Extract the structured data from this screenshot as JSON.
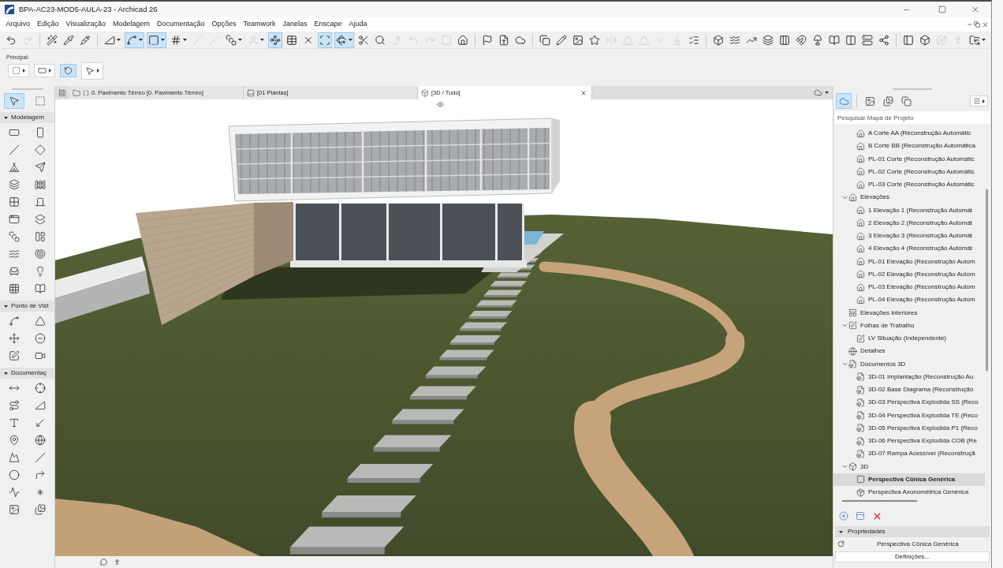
{
  "window": {
    "title": "BPA-AC23-MOD5-AULA-23 - Archicad 26"
  },
  "menu": [
    "Arquivo",
    "Edição",
    "Visualização",
    "Modelagem",
    "Documentação",
    "Opções",
    "Teamwork",
    "Janelas",
    "Enscape",
    "Ajuda"
  ],
  "toolbar": [
    {
      "on": false,
      "disabled": false
    },
    {
      "on": false,
      "disabled": true
    },
    {
      "on": false,
      "disabled": false
    },
    {
      "on": false,
      "disabled": false
    },
    {
      "on": false,
      "disabled": false
    },
    {
      "on": false,
      "disabled": false
    },
    {
      "on": true,
      "disabled": false
    },
    {
      "on": true,
      "disabled": false
    },
    {
      "on": false,
      "disabled": false
    },
    {
      "on": false,
      "disabled": true
    },
    {
      "on": false,
      "disabled": true
    },
    {
      "on": false,
      "disabled": false
    },
    {
      "on": false,
      "disabled": true
    },
    {
      "on": true,
      "disabled": false
    },
    {
      "on": false,
      "disabled": false
    },
    {
      "on": false,
      "disabled": false
    },
    {
      "on": true,
      "disabled": false
    },
    {
      "on": true,
      "disabled": false
    },
    {
      "on": false,
      "disabled": false
    },
    {
      "on": false,
      "disabled": false
    },
    {
      "on": false,
      "disabled": true
    },
    {
      "on": false,
      "disabled": true
    },
    {
      "on": false,
      "disabled": true
    },
    {
      "on": false,
      "disabled": true
    },
    {
      "on": false,
      "disabled": false
    },
    {
      "on": false,
      "disabled": false
    },
    {
      "on": false,
      "disabled": false
    },
    {
      "on": false,
      "disabled": false
    },
    {
      "on": false,
      "disabled": false
    },
    {
      "on": false,
      "disabled": false
    },
    {
      "on": false,
      "disabled": false
    },
    {
      "on": false,
      "disabled": false
    },
    {
      "on": false,
      "disabled": true
    },
    {
      "on": false,
      "disabled": true
    },
    {
      "on": false,
      "disabled": true
    },
    {
      "on": false,
      "disabled": true
    },
    {
      "on": false,
      "disabled": true
    },
    {
      "on": false,
      "disabled": false
    },
    {
      "on": false,
      "disabled": false
    },
    {
      "on": false,
      "disabled": false
    },
    {
      "on": false,
      "disabled": false
    },
    {
      "on": false,
      "disabled": false
    },
    {
      "on": false,
      "disabled": false
    },
    {
      "on": false,
      "disabled": false
    },
    {
      "on": false,
      "disabled": false
    },
    {
      "on": false,
      "disabled": false
    },
    {
      "on": false,
      "disabled": false
    },
    {
      "on": false,
      "disabled": false
    },
    {
      "on": false,
      "disabled": false
    },
    {
      "on": false,
      "disabled": false
    },
    {
      "on": false,
      "disabled": false
    },
    {
      "on": false,
      "disabled": true
    },
    {
      "on": false,
      "disabled": true
    },
    {
      "on": false,
      "disabled": false
    }
  ],
  "toolbar_2": {
    "label": "Principal:",
    "buttons": [
      {
        "on": false
      },
      {
        "on": false
      },
      {
        "on": true
      },
      {
        "on": false
      }
    ]
  },
  "toolbox": {
    "top_tools": [
      {
        "selected": true
      },
      {
        "selected": false
      }
    ],
    "sections": [
      {
        "label": "Modelagem",
        "expanded": true,
        "tools": [
          {
            "selected": false
          },
          {
            "selected": false
          },
          {
            "selected": false
          },
          {
            "selected": false
          },
          {
            "selected": false
          },
          {
            "selected": false
          },
          {
            "selected": false
          },
          {
            "selected": false
          },
          {
            "selected": false
          },
          {
            "selected": false
          },
          {
            "selected": false
          },
          {
            "selected": false
          },
          {
            "selected": false
          },
          {
            "selected": false
          },
          {
            "selected": false
          },
          {
            "selected": false
          },
          {
            "selected": false
          },
          {
            "selected": false
          },
          {
            "selected": false
          },
          {
            "selected": false
          }
        ]
      },
      {
        "label": "Ponto de Vist",
        "expanded": true,
        "tools": [
          {
            "selected": false
          },
          {
            "selected": false
          },
          {
            "selected": false
          },
          {
            "selected": false
          },
          {
            "selected": false
          },
          {
            "selected": false
          }
        ]
      },
      {
        "label": "Documentaç",
        "expanded": true,
        "tools": [
          {
            "selected": false
          },
          {
            "selected": false
          },
          {
            "selected": false
          },
          {
            "selected": false
          },
          {
            "selected": false
          },
          {
            "selected": false
          },
          {
            "selected": false
          },
          {
            "selected": false
          },
          {
            "selected": false
          },
          {
            "selected": false
          },
          {
            "selected": false
          },
          {
            "selected": false
          },
          {
            "selected": false
          },
          {
            "selected": false
          },
          {
            "selected": false
          },
          {
            "selected": false
          }
        ]
      }
    ]
  },
  "tabs": [
    {
      "kind": "story",
      "label": "0. Pavimento Térreo [0. Pavimento Térreo]",
      "selected": false
    },
    {
      "kind": "layout",
      "label": "[01 Plantas]",
      "selected": false
    },
    {
      "kind": "model",
      "label": "[3D / Tudo]",
      "selected": true
    }
  ],
  "navigator": {
    "tabs": [
      {
        "selected": true
      },
      {
        "selected": false
      },
      {
        "selected": false
      },
      {
        "selected": false
      }
    ],
    "search": {
      "placeholder": "Pesquisar Mapa de Projeto"
    },
    "tree": [
      {
        "children": [
          {
            "label": "A Corte AA (Reconstrução Automátic",
            "kind": "view",
            "selected": false
          },
          {
            "label": "B Corte BB (Reconstrução Automática",
            "kind": "view",
            "selected": false
          },
          {
            "label": "PL-01 Corte (Reconstrução Automátic",
            "kind": "view",
            "selected": false
          },
          {
            "label": "PL-02 Corte (Reconstrução Automátic",
            "kind": "view",
            "selected": false
          },
          {
            "label": "PL-03 Corte (Reconstrução Automátic",
            "kind": "view",
            "selected": false
          }
        ]
      },
      {
        "label": "Elevações",
        "kind": "view",
        "expanded": true,
        "selected": false,
        "children": [
          {
            "label": "1 Elevação 1 (Reconstrução Automát",
            "kind": "view",
            "selected": false
          },
          {
            "label": "2 Elevação 2 (Reconstrução Automát",
            "kind": "view",
            "selected": false
          },
          {
            "label": "3 Elevação 3 (Reconstrução Automát",
            "kind": "view",
            "selected": false
          },
          {
            "label": "4 Elevação 4 (Reconstrução Automát",
            "kind": "view",
            "selected": false
          },
          {
            "label": "PL-01 Elevação (Reconstrução Autom",
            "kind": "view",
            "selected": false
          },
          {
            "label": "PL-02 Elevação (Reconstrução Autom",
            "kind": "view",
            "selected": false
          },
          {
            "label": "PL-03 Elevação (Reconstrução Autom",
            "kind": "view",
            "selected": false
          },
          {
            "label": "PL-04 Elevação (Reconstrução Autom",
            "kind": "view",
            "selected": false
          }
        ]
      },
      {
        "label": "Elevações Interiores",
        "kind": "interior",
        "selected": false
      },
      {
        "label": "Folhas de Trabalho",
        "kind": "worksheet",
        "expanded": true,
        "selected": false,
        "children": [
          {
            "label": "LV Situação (Independente)",
            "kind": "worksheet",
            "selected": false
          }
        ]
      },
      {
        "label": "Detalhes",
        "kind": "detail",
        "selected": false
      },
      {
        "label": "Documentos 3D",
        "kind": "doc3d",
        "expanded": true,
        "selected": false,
        "children": [
          {
            "label": "3D-01 Implantação (Reconstrução Au",
            "kind": "doc3d",
            "selected": false
          },
          {
            "label": "3D-02 Base Diagrama (Reconstrução",
            "kind": "doc3d",
            "selected": false
          },
          {
            "label": "3D-03 Perspectiva Explodida SS (Reco",
            "kind": "doc3d",
            "selected": false
          },
          {
            "label": "3D-04 Perspectiva Explodida TE (Reco",
            "kind": "doc3d",
            "selected": false
          },
          {
            "label": "3D-05 Perspectiva Explodida P1 (Reco",
            "kind": "doc3d",
            "selected": false
          },
          {
            "label": "3D-06 Perspectiva Explodida COB (Re",
            "kind": "doc3d",
            "selected": false
          },
          {
            "label": "3D-07 Rampa Acessível (Reconstruçã",
            "kind": "doc3d",
            "selected": false
          }
        ]
      },
      {
        "label": "3D",
        "kind": "model",
        "expanded": true,
        "selected": false,
        "children": [
          {
            "label": "Perspectiva Cônica Genérica",
            "kind": "perspective",
            "selected": true
          },
          {
            "label": "Perspectiva Axonométrica Genérica",
            "kind": "axonometric",
            "selected": false
          }
        ]
      }
    ]
  },
  "properties": {
    "title": "Propriedades",
    "expanded": true,
    "view_name": "Perspectiva Cônica Genérica",
    "button": "Definições..."
  }
}
